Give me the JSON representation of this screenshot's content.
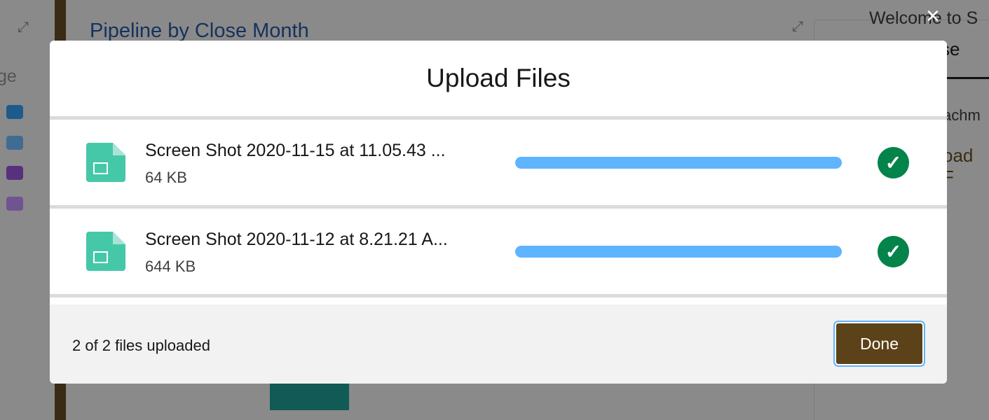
{
  "background": {
    "chart_title": "Pipeline by Close Month",
    "legend_label": "ge",
    "welcome": "Welcome to S",
    "tab": "se",
    "attachments": "achm",
    "upload": "oad F",
    "legend_colors": [
      "#1d5a8e",
      "#406c92",
      "#58307e",
      "#6f5491"
    ]
  },
  "modal": {
    "title": "Upload Files",
    "files": [
      {
        "name": "Screen Shot 2020-11-15 at 11.05.43 ...",
        "size": "64 KB",
        "progress": 100,
        "status": "complete"
      },
      {
        "name": "Screen Shot 2020-11-12 at 8.21.21 A...",
        "size": "644 KB",
        "progress": 100,
        "status": "complete"
      }
    ],
    "footer_status": "2 of 2 files uploaded",
    "done_label": "Done",
    "close_icon": "×",
    "check_icon": "✓"
  }
}
